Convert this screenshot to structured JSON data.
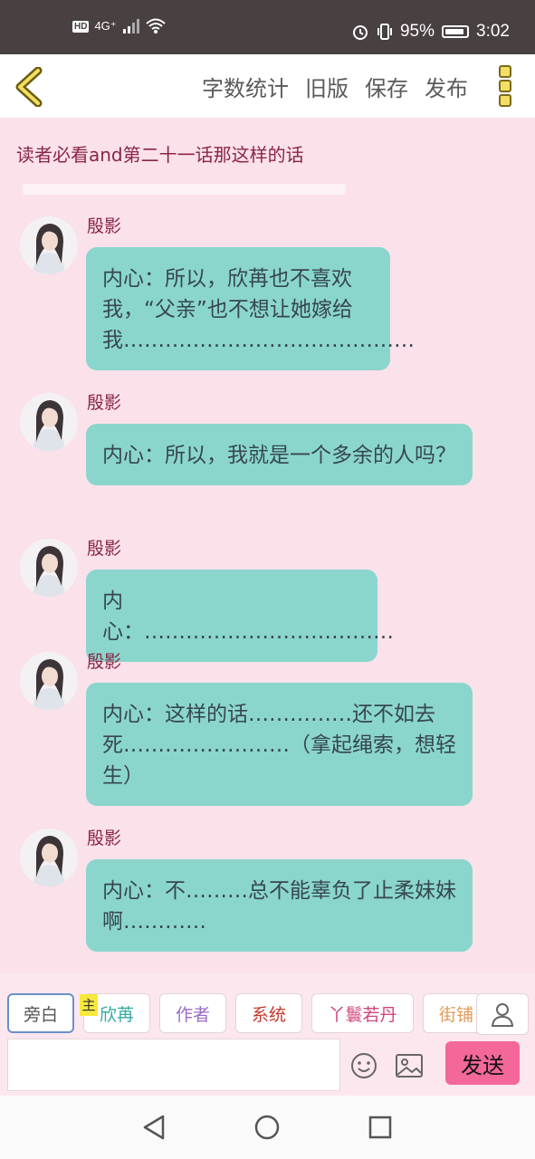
{
  "status": {
    "network": "4G⁺",
    "battery": "95%",
    "time": "3:02",
    "hd": "HD"
  },
  "toolbar": {
    "word_count": "字数统计",
    "old_version": "旧版",
    "save": "保存",
    "publish": "发布"
  },
  "chapter_title": "读者必看and第二十一话那这样的话",
  "messages": [
    {
      "name": "殷影",
      "text": "内心：所以，欣苒也不喜欢我，“父亲”也不想让她嫁给我……………………………………"
    },
    {
      "name": "殷影",
      "text": "内心：所以，我就是一个多余的人吗？"
    },
    {
      "name": "殷影",
      "text": "内心：………………………………"
    },
    {
      "name": "殷影",
      "text": "内心：这样的话……………还不如去死……………………（拿起绳索，想轻生）"
    },
    {
      "name": "殷影",
      "text": "内心：不………总不能辜负了止柔妹妹啊…………"
    }
  ],
  "characters": [
    {
      "label": "旁白",
      "color": "#555555"
    },
    {
      "label": "欣苒",
      "color": "#33a9a0"
    },
    {
      "label": "作者",
      "color": "#9a6cc9"
    },
    {
      "label": "系统",
      "color": "#c0392b"
    },
    {
      "label": "丫鬟若丹",
      "color": "#d0457a"
    },
    {
      "label": "街铺",
      "color": "#e09a5a"
    }
  ],
  "main_badge": "主",
  "send_label": "发送",
  "colors": {
    "bubble": "#8ad6cd",
    "background": "#fae1ea",
    "send": "#f4679a",
    "name": "#8a2545"
  }
}
